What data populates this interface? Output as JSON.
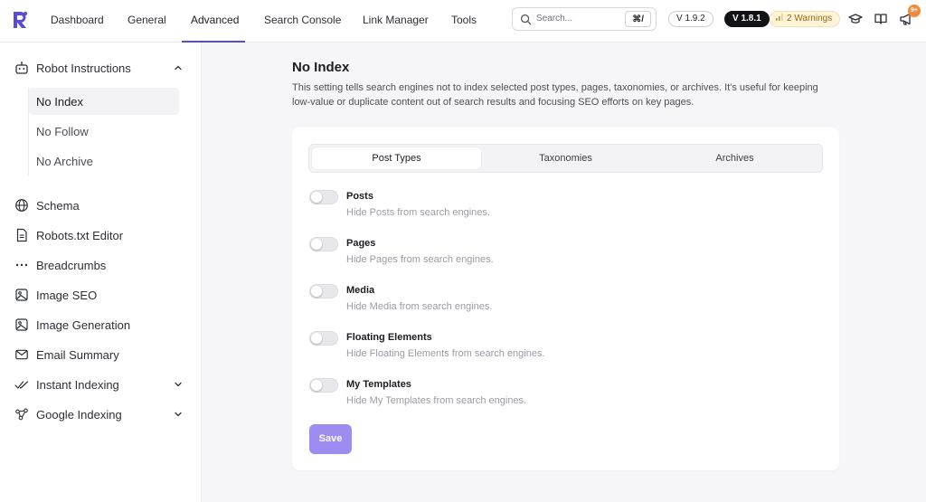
{
  "brand": {
    "logo_icon": "rankmath-logo-icon",
    "accent": "#5a4bd6"
  },
  "nav": {
    "tabs": [
      {
        "label": "Dashboard"
      },
      {
        "label": "General"
      },
      {
        "label": "Advanced",
        "active": true
      },
      {
        "label": "Search Console"
      },
      {
        "label": "Link Manager"
      },
      {
        "label": "Tools"
      }
    ]
  },
  "search": {
    "placeholder": "Search...",
    "shortcut": "⌘/"
  },
  "badges": {
    "version_free": "V 1.9.2",
    "version_pro": "V 1.8.1",
    "warnings": "2 Warnings"
  },
  "notifications": {
    "count": "9+"
  },
  "sidebar": {
    "items": [
      {
        "label": "Robot Instructions",
        "icon": "robot-icon",
        "expanded": true,
        "children": [
          {
            "label": "No Index",
            "active": true
          },
          {
            "label": "No Follow"
          },
          {
            "label": "No Archive"
          }
        ]
      },
      {
        "label": "Schema",
        "icon": "globe-icon"
      },
      {
        "label": "Robots.txt Editor",
        "icon": "document-icon"
      },
      {
        "label": "Breadcrumbs",
        "icon": "dots-icon"
      },
      {
        "label": "Image SEO",
        "icon": "image-icon"
      },
      {
        "label": "Image Generation",
        "icon": "image-icon"
      },
      {
        "label": "Email Summary",
        "icon": "mail-icon"
      },
      {
        "label": "Instant Indexing",
        "icon": "double-check-icon"
      },
      {
        "label": "Google Indexing",
        "icon": "network-icon"
      }
    ]
  },
  "main": {
    "title": "No Index",
    "description": "This setting tells search engines not to index selected post types, pages, taxonomies, or archives. It's useful for keeping low-value or duplicate content out of search results and focusing SEO efforts on key pages.",
    "tabs": [
      {
        "label": "Post Types",
        "active": true
      },
      {
        "label": "Taxonomies"
      },
      {
        "label": "Archives"
      }
    ],
    "options": [
      {
        "title": "Posts",
        "desc": "Hide Posts from search engines.",
        "enabled": false
      },
      {
        "title": "Pages",
        "desc": "Hide Pages from search engines.",
        "enabled": false
      },
      {
        "title": "Media",
        "desc": "Hide Media from search engines.",
        "enabled": false
      },
      {
        "title": "Floating Elements",
        "desc": "Hide Floating Elements from search engines.",
        "enabled": false
      },
      {
        "title": "My Templates",
        "desc": "Hide My Templates from search engines.",
        "enabled": false
      }
    ],
    "save_label": "Save"
  }
}
